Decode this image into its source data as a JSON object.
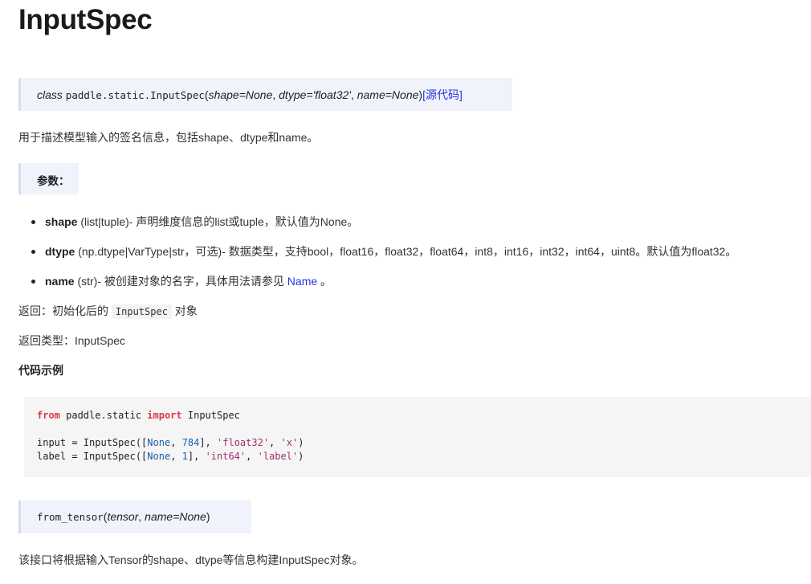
{
  "title": "InputSpec",
  "class_sig": {
    "prefix": "class",
    "name": "paddle.static.InputSpec",
    "open": "(",
    "p1": "shape=None",
    "sep1": ", ",
    "p2": "dtype='float32'",
    "sep2": ", ",
    "p3": "name=None",
    "close": ")",
    "source_link": "[源代码]"
  },
  "description": "用于描述模型输入的签名信息，包括shape、dtype和name。",
  "params_heading": "参数：",
  "params": [
    {
      "name": "shape",
      "rest": " (list|tuple)- 声明维度信息的list或tuple，默认值为None。"
    },
    {
      "name": "dtype",
      "rest": " (np.dtype|VarType|str，可选)- 数据类型，支持bool，float16，float32，float64，int8，int16，int32，int64，uint8。默认值为float32。"
    },
    {
      "name": "name",
      "rest": " (str)- 被创建对象的名字，具体用法请参见 ",
      "link": "Name",
      "tail": " 。"
    }
  ],
  "returns": {
    "prefix": "返回：初始化后的 ",
    "code": "InputSpec",
    "suffix": " 对象"
  },
  "return_type": "返回类型：InputSpec",
  "example_heading": "代码示例",
  "code": {
    "l1_kw1": "from",
    "l1_mod": " paddle.static ",
    "l1_kw2": "import",
    "l1_name": " InputSpec",
    "l2_a": "input = InputSpec([",
    "l2_none": "None",
    "l2_b": ", ",
    "l2_num": "784",
    "l2_c": "], ",
    "l2_s1": "'float32'",
    "l2_d": ", ",
    "l2_s2": "'x'",
    "l2_e": ")",
    "l3_a": "label = InputSpec([",
    "l3_none": "None",
    "l3_b": ", ",
    "l3_num": "1",
    "l3_c": "], ",
    "l3_s1": "'int64'",
    "l3_d": ", ",
    "l3_s2": "'label'",
    "l3_e": ")"
  },
  "from_tensor_sig": {
    "name": "from_tensor",
    "open": "(",
    "p1": "tensor",
    "sep": ", ",
    "p2": "name=None",
    "close": ")"
  },
  "from_tensor_desc": "该接口将根据输入Tensor的shape、dtype等信息构建InputSpec对象。"
}
